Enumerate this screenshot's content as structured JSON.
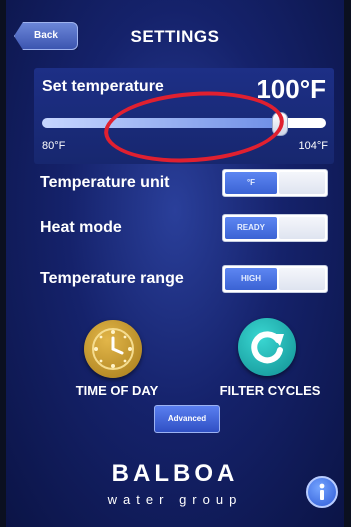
{
  "header": {
    "back_label": "Back",
    "title": "SETTINGS"
  },
  "temperature": {
    "set_label": "Set temperature",
    "value": "100°F",
    "min_label": "80°F",
    "max_label": "104°F",
    "slider_value": 100,
    "slider_min": 80,
    "slider_max": 104
  },
  "settings": [
    {
      "label": "Temperature unit",
      "toggle_value": "°F"
    },
    {
      "label": "Heat mode",
      "toggle_value": "READY"
    },
    {
      "label": "Temperature range",
      "toggle_value": "HIGH"
    }
  ],
  "buttons": {
    "time_of_day": "TIME OF DAY",
    "filter_cycles": "FILTER CYCLES",
    "advanced": "Advanced"
  },
  "footer": {
    "brand": "BALBOA",
    "tagline": "water group",
    "info_icon": "info-icon"
  },
  "annotation": {
    "color": "#e02030",
    "shape": "red-ellipse-around-slider-thumb"
  },
  "colors": {
    "background": "#15226b",
    "accent": "#3b63d4",
    "clock_gold": "#c9962b",
    "filter_teal": "#1bb1b0"
  }
}
